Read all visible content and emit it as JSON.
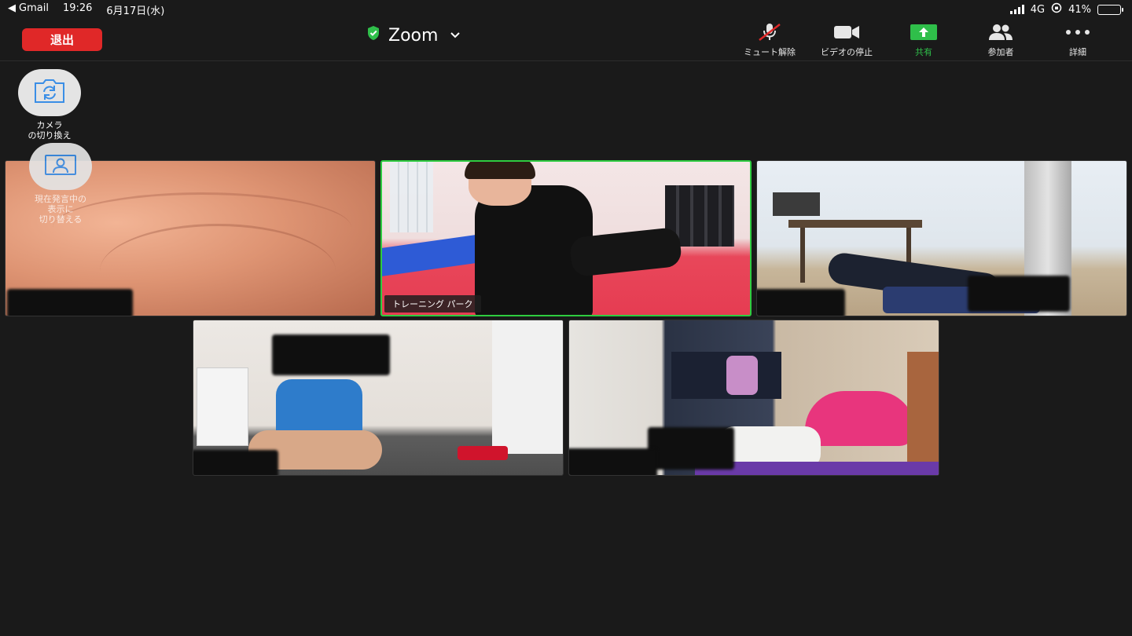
{
  "status_bar": {
    "back_app": "Gmail",
    "time": "19:26",
    "date": "6月17日(水)",
    "network": "4G",
    "battery": "41%",
    "battery_level": 0.41
  },
  "toolbar": {
    "leave_label": "退出",
    "meeting_title": "Zoom",
    "colors": {
      "leave": "#e02828",
      "share": "#2fbf4a",
      "secure": "#2fbf4a",
      "active_speaker": "#2ecc40"
    },
    "items": [
      {
        "label": "ミュート解除",
        "icon": "mic-muted-icon"
      },
      {
        "label": "ビデオの停止",
        "icon": "video-camera-icon"
      },
      {
        "label": "共有",
        "icon": "share-arrow-icon"
      },
      {
        "label": "参加者",
        "icon": "participants-icon"
      },
      {
        "label": "詳細",
        "icon": "more-dots-icon"
      }
    ]
  },
  "floating": {
    "switch_camera_label": "カメラ\nの切り換え",
    "switch_view_label": "現在発言中の\n表示に\n切り替える"
  },
  "tiles": {
    "active_speaker_name": "トレーニング パーク"
  }
}
